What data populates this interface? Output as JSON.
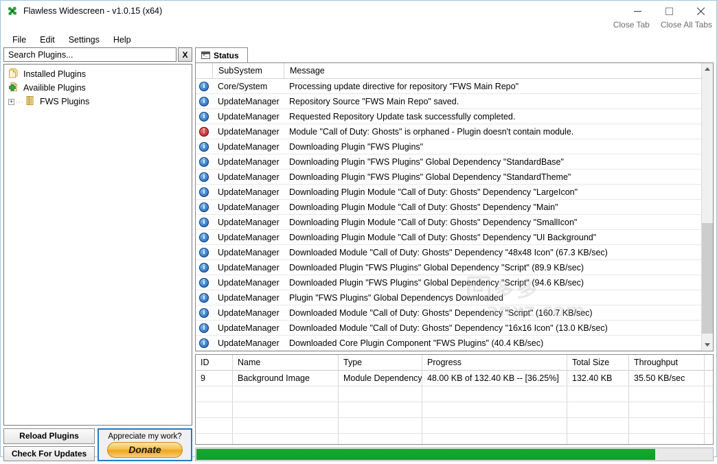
{
  "window": {
    "title": "Flawless Widescreen - v1.0.15 (x64)",
    "app_icon": "pinwheel-icon",
    "minimize": "minimize-icon",
    "maximize": "maximize-icon",
    "close": "close-icon",
    "close_tab": "Close Tab",
    "close_all_tabs": "Close All Tabs"
  },
  "menu": {
    "items": [
      {
        "label": "File"
      },
      {
        "label": "Edit"
      },
      {
        "label": "Settings"
      },
      {
        "label": "Help"
      }
    ]
  },
  "sidebar": {
    "search": {
      "value": "",
      "placeholder": "Search Plugins...",
      "clear_label": "X"
    },
    "tree": [
      {
        "label": "Installed Plugins",
        "icon": "stacked-pages-icon",
        "expander": "",
        "indent": 0
      },
      {
        "label": "Availible Plugins",
        "icon": "page-plus-icon",
        "expander": "",
        "indent": 0
      },
      {
        "label": "FWS Plugins",
        "icon": "book-icon",
        "expander": "+",
        "indent": 1
      }
    ],
    "buttons": [
      {
        "label": "Reload Plugins"
      },
      {
        "label": "Check For Updates"
      }
    ],
    "donate": {
      "prompt": "Appreciate my work?",
      "button": "Donate",
      "border_color": "#1e7bc8",
      "button_color": "#efa523"
    }
  },
  "tabs": [
    {
      "label": "Status",
      "icon": "console-icon",
      "active": true
    }
  ],
  "log": {
    "columns": [
      "",
      "SubSystem",
      "Message"
    ],
    "rows": [
      {
        "level": "info",
        "subsystem": "Core/System",
        "message": "Processing update directive for repository \"FWS Main Repo\""
      },
      {
        "level": "info",
        "subsystem": "UpdateManager",
        "message": "Repository Source \"FWS Main Repo\" saved."
      },
      {
        "level": "info",
        "subsystem": "UpdateManager",
        "message": "Requested Repository Update task successfully completed."
      },
      {
        "level": "error",
        "subsystem": "UpdateManager",
        "message": "Module \"Call of Duty: Ghosts\" is orphaned - Plugin doesn't contain module."
      },
      {
        "level": "info",
        "subsystem": "UpdateManager",
        "message": "Downloading Plugin \"FWS Plugins\""
      },
      {
        "level": "info",
        "subsystem": "UpdateManager",
        "message": "Downloading Plugin \"FWS Plugins\" Global Dependency \"StandardBase\""
      },
      {
        "level": "info",
        "subsystem": "UpdateManager",
        "message": "Downloading Plugin \"FWS Plugins\" Global Dependency \"StandardTheme\""
      },
      {
        "level": "info",
        "subsystem": "UpdateManager",
        "message": "Downloading Plugin Module \"Call of Duty: Ghosts\" Dependency \"LargeIcon\""
      },
      {
        "level": "info",
        "subsystem": "UpdateManager",
        "message": "Downloading Plugin Module \"Call of Duty: Ghosts\" Dependency \"Main\""
      },
      {
        "level": "info",
        "subsystem": "UpdateManager",
        "message": "Downloading Plugin Module \"Call of Duty: Ghosts\" Dependency \"SmallIcon\""
      },
      {
        "level": "info",
        "subsystem": "UpdateManager",
        "message": "Downloading Plugin Module \"Call of Duty: Ghosts\" Dependency \"UI Background\""
      },
      {
        "level": "info",
        "subsystem": "UpdateManager",
        "message": "Downloaded Module \"Call of Duty: Ghosts\" Dependency \"48x48 Icon\" (67.3 KB/sec)"
      },
      {
        "level": "info",
        "subsystem": "UpdateManager",
        "message": "Downloaded Plugin \"FWS Plugins\" Global Dependency \"Script\" (89.9 KB/sec)"
      },
      {
        "level": "info",
        "subsystem": "UpdateManager",
        "message": "Downloaded Plugin \"FWS Plugins\" Global Dependency \"Script\" (94.6 KB/sec)"
      },
      {
        "level": "info",
        "subsystem": "UpdateManager",
        "message": "Plugin \"FWS Plugins\" Global Dependencys Downloaded"
      },
      {
        "level": "info",
        "subsystem": "UpdateManager",
        "message": "Downloaded Module \"Call of Duty: Ghosts\" Dependency \"Script\" (160.7 KB/sec)"
      },
      {
        "level": "info",
        "subsystem": "UpdateManager",
        "message": "Downloaded Module \"Call of Duty: Ghosts\" Dependency \"16x16 Icon\" (13.0 KB/sec)"
      },
      {
        "level": "info",
        "subsystem": "UpdateManager",
        "message": "Downloaded Core Plugin Component \"FWS Plugins\" (40.4 KB/sec)"
      }
    ],
    "scroll": {
      "up": "scroll-up-arrow",
      "down": "scroll-down-arrow",
      "thumb_top_pct": 56,
      "thumb_height_pct": 42
    }
  },
  "downloads": {
    "columns": [
      "ID",
      "Name",
      "Type",
      "Progress",
      "Total Size",
      "Throughput"
    ],
    "rows": [
      {
        "id": "9",
        "name": "Background Image",
        "type": "Module Dependency",
        "progress": "48.00 KB of 132.40 KB -- [36.25%]",
        "total_size": "132.40 KB",
        "throughput": "35.50 KB/sec"
      }
    ]
  },
  "progress_bar": {
    "percent": 89,
    "color": "#12a22c"
  },
  "watermark": {
    "cn": "多多",
    "site": "anxz.com"
  }
}
